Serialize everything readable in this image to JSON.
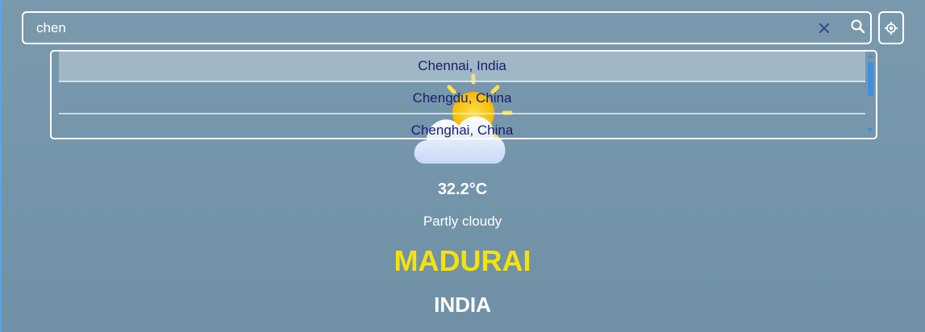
{
  "search": {
    "value": "chen",
    "clear_icon": "close-icon",
    "search_icon": "search-icon",
    "locate_icon": "my-location-icon"
  },
  "suggestions": [
    {
      "label": "Chennai, India",
      "active": true
    },
    {
      "label": "Chengdu, China",
      "active": false
    },
    {
      "label": "Chenghai, China",
      "active": false
    }
  ],
  "weather": {
    "icon": "partly-cloudy-icon",
    "temperature": "32.2°C",
    "condition": "Partly cloudy",
    "city": "MADURAI",
    "country": "INDIA"
  },
  "colors": {
    "accent_city": "#f5e20a",
    "suggestion_text": "#1c1c6e",
    "scrollbar": "#3f8fe0",
    "clear_icon": "#3b4a8c"
  }
}
